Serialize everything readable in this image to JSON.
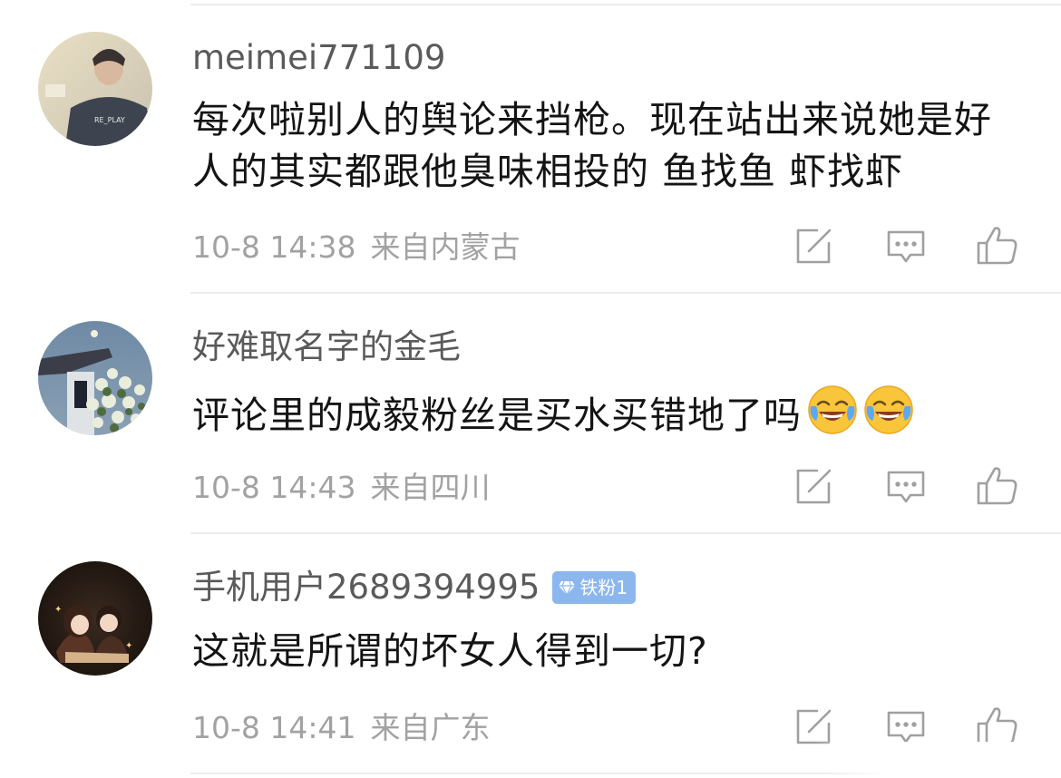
{
  "comments": [
    {
      "username": "meimei771109",
      "badge": null,
      "content": "每次啦别人的舆论来挡枪。现在站出来说她是好人的其实都跟他臭味相投的 鱼找鱼 虾找虾",
      "time": "10-8 14:38",
      "location": "来自内蒙古",
      "avatar_text": "RE_PLAY"
    },
    {
      "username": "好难取名字的金毛",
      "badge": null,
      "content": "评论里的成毅粉丝是买水买错地了吗",
      "emojis": [
        "laughing-crying-emoji",
        "laughing-crying-emoji"
      ],
      "time": "10-8 14:43",
      "location": "来自四川"
    },
    {
      "username": "手机用户2689394995",
      "badge": "铁粉1",
      "content": "这就是所谓的坏女人得到一切?",
      "time": "10-8 14:41",
      "location": "来自广东"
    }
  ],
  "icons": {
    "repost": "repost-icon",
    "comment": "comment-icon",
    "like": "like-icon",
    "badge": "diamond-icon"
  },
  "colors": {
    "username": "#5a5a5a",
    "content": "#141414",
    "meta": "#a2a2a2",
    "badge": "#8bb7ee",
    "divider": "#ececec"
  }
}
